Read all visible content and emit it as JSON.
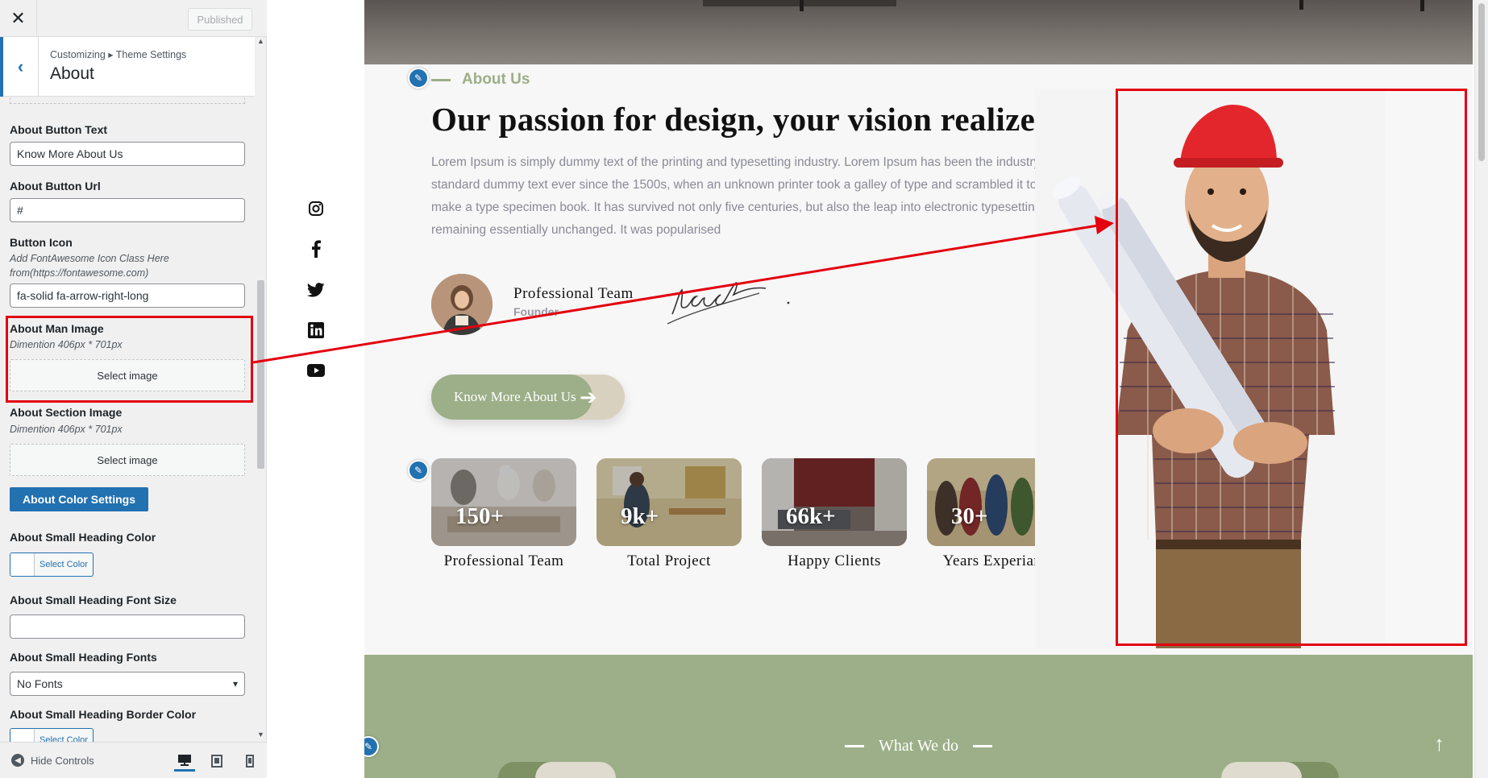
{
  "panel": {
    "close_icon": "close-icon",
    "published_label": "Published",
    "breadcrumb": "Customizing ▸ Theme Settings",
    "section_title": "About",
    "fields": {
      "button_text_label": "About Button Text",
      "button_text_value": "Know More About Us",
      "button_url_label": "About Button Url",
      "button_url_value": "#",
      "button_icon_label": "Button Icon",
      "button_icon_desc": "Add FontAwesome Icon Class Here from(https://fontawesome.com)",
      "button_icon_value": "fa-solid fa-arrow-right-long",
      "man_image_label": "About Man Image",
      "man_image_desc": "Dimention 406px * 701px",
      "man_image_btn": "Select image",
      "section_image_label": "About Section Image",
      "section_image_desc": "Dimention 406px * 701px",
      "section_image_btn": "Select image",
      "color_settings_btn": "About Color Settings",
      "small_heading_color_label": "About Small Heading Color",
      "select_color": "Select Color",
      "small_heading_font_size_label": "About Small Heading Font Size",
      "small_heading_font_size_value": "",
      "small_heading_fonts_label": "About Small Heading Fonts",
      "small_heading_fonts_value": "No Fonts",
      "small_heading_border_color_label": "About Small Heading Border Color",
      "select_color_2": "Select Color"
    },
    "footer": {
      "hide_controls": "Hide Controls",
      "devices": [
        "desktop",
        "tablet",
        "mobile"
      ],
      "active_device": "desktop"
    },
    "accent": "#2271b1"
  },
  "social": [
    "instagram-icon",
    "facebook-icon",
    "twitter-icon",
    "linkedin-icon",
    "youtube-icon"
  ],
  "about": {
    "small_heading": "About Us",
    "heading": "Our passion for design, your vision realized",
    "paragraph": "Lorem Ipsum is simply dummy text of the printing and typesetting industry. Lorem Ipsum has been the industry's standard dummy text ever since the 1500s, when an unknown printer took a galley of type and scrambled it to make a type specimen book. It has survived not only five centuries, but also the leap into electronic typesetting, remaining essentially unchanged. It was popularised",
    "founder_name": "Professional Team",
    "founder_role": "Founder",
    "button_label": "Know More About Us",
    "button_arrow": "➔",
    "stats": [
      {
        "number": "150+",
        "label": "Professional Team"
      },
      {
        "number": "9k+",
        "label": "Total Project"
      },
      {
        "number": "66k+",
        "label": "Happy Clients"
      },
      {
        "number": "30+",
        "label": "Years Experiance"
      }
    ],
    "accent": "#9caf88"
  },
  "what_we_do": {
    "small_heading": "What We do",
    "up_arrow": "↑"
  },
  "annotation_color": "#e3000f"
}
